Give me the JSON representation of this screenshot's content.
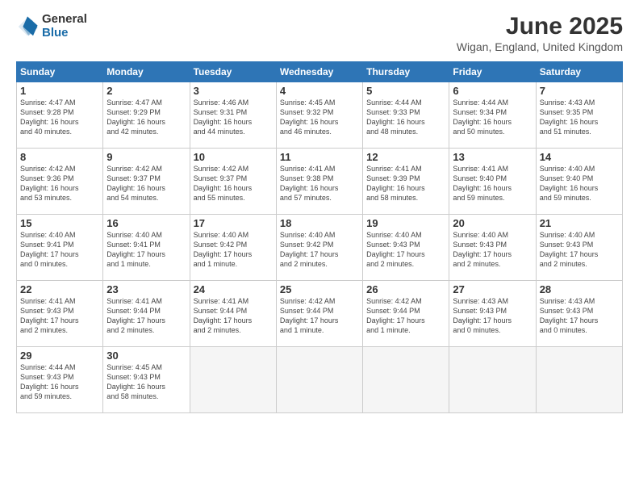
{
  "logo": {
    "general": "General",
    "blue": "Blue"
  },
  "title": "June 2025",
  "location": "Wigan, England, United Kingdom",
  "days_of_week": [
    "Sunday",
    "Monday",
    "Tuesday",
    "Wednesday",
    "Thursday",
    "Friday",
    "Saturday"
  ],
  "weeks": [
    [
      {
        "day": "1",
        "info": "Sunrise: 4:47 AM\nSunset: 9:28 PM\nDaylight: 16 hours\nand 40 minutes."
      },
      {
        "day": "2",
        "info": "Sunrise: 4:47 AM\nSunset: 9:29 PM\nDaylight: 16 hours\nand 42 minutes."
      },
      {
        "day": "3",
        "info": "Sunrise: 4:46 AM\nSunset: 9:31 PM\nDaylight: 16 hours\nand 44 minutes."
      },
      {
        "day": "4",
        "info": "Sunrise: 4:45 AM\nSunset: 9:32 PM\nDaylight: 16 hours\nand 46 minutes."
      },
      {
        "day": "5",
        "info": "Sunrise: 4:44 AM\nSunset: 9:33 PM\nDaylight: 16 hours\nand 48 minutes."
      },
      {
        "day": "6",
        "info": "Sunrise: 4:44 AM\nSunset: 9:34 PM\nDaylight: 16 hours\nand 50 minutes."
      },
      {
        "day": "7",
        "info": "Sunrise: 4:43 AM\nSunset: 9:35 PM\nDaylight: 16 hours\nand 51 minutes."
      }
    ],
    [
      {
        "day": "8",
        "info": "Sunrise: 4:42 AM\nSunset: 9:36 PM\nDaylight: 16 hours\nand 53 minutes."
      },
      {
        "day": "9",
        "info": "Sunrise: 4:42 AM\nSunset: 9:37 PM\nDaylight: 16 hours\nand 54 minutes."
      },
      {
        "day": "10",
        "info": "Sunrise: 4:42 AM\nSunset: 9:37 PM\nDaylight: 16 hours\nand 55 minutes."
      },
      {
        "day": "11",
        "info": "Sunrise: 4:41 AM\nSunset: 9:38 PM\nDaylight: 16 hours\nand 57 minutes."
      },
      {
        "day": "12",
        "info": "Sunrise: 4:41 AM\nSunset: 9:39 PM\nDaylight: 16 hours\nand 58 minutes."
      },
      {
        "day": "13",
        "info": "Sunrise: 4:41 AM\nSunset: 9:40 PM\nDaylight: 16 hours\nand 59 minutes."
      },
      {
        "day": "14",
        "info": "Sunrise: 4:40 AM\nSunset: 9:40 PM\nDaylight: 16 hours\nand 59 minutes."
      }
    ],
    [
      {
        "day": "15",
        "info": "Sunrise: 4:40 AM\nSunset: 9:41 PM\nDaylight: 17 hours\nand 0 minutes."
      },
      {
        "day": "16",
        "info": "Sunrise: 4:40 AM\nSunset: 9:41 PM\nDaylight: 17 hours\nand 1 minute."
      },
      {
        "day": "17",
        "info": "Sunrise: 4:40 AM\nSunset: 9:42 PM\nDaylight: 17 hours\nand 1 minute."
      },
      {
        "day": "18",
        "info": "Sunrise: 4:40 AM\nSunset: 9:42 PM\nDaylight: 17 hours\nand 2 minutes."
      },
      {
        "day": "19",
        "info": "Sunrise: 4:40 AM\nSunset: 9:43 PM\nDaylight: 17 hours\nand 2 minutes."
      },
      {
        "day": "20",
        "info": "Sunrise: 4:40 AM\nSunset: 9:43 PM\nDaylight: 17 hours\nand 2 minutes."
      },
      {
        "day": "21",
        "info": "Sunrise: 4:40 AM\nSunset: 9:43 PM\nDaylight: 17 hours\nand 2 minutes."
      }
    ],
    [
      {
        "day": "22",
        "info": "Sunrise: 4:41 AM\nSunset: 9:43 PM\nDaylight: 17 hours\nand 2 minutes."
      },
      {
        "day": "23",
        "info": "Sunrise: 4:41 AM\nSunset: 9:44 PM\nDaylight: 17 hours\nand 2 minutes."
      },
      {
        "day": "24",
        "info": "Sunrise: 4:41 AM\nSunset: 9:44 PM\nDaylight: 17 hours\nand 2 minutes."
      },
      {
        "day": "25",
        "info": "Sunrise: 4:42 AM\nSunset: 9:44 PM\nDaylight: 17 hours\nand 1 minute."
      },
      {
        "day": "26",
        "info": "Sunrise: 4:42 AM\nSunset: 9:44 PM\nDaylight: 17 hours\nand 1 minute."
      },
      {
        "day": "27",
        "info": "Sunrise: 4:43 AM\nSunset: 9:43 PM\nDaylight: 17 hours\nand 0 minutes."
      },
      {
        "day": "28",
        "info": "Sunrise: 4:43 AM\nSunset: 9:43 PM\nDaylight: 17 hours\nand 0 minutes."
      }
    ],
    [
      {
        "day": "29",
        "info": "Sunrise: 4:44 AM\nSunset: 9:43 PM\nDaylight: 16 hours\nand 59 minutes."
      },
      {
        "day": "30",
        "info": "Sunrise: 4:45 AM\nSunset: 9:43 PM\nDaylight: 16 hours\nand 58 minutes."
      },
      {
        "day": "",
        "info": ""
      },
      {
        "day": "",
        "info": ""
      },
      {
        "day": "",
        "info": ""
      },
      {
        "day": "",
        "info": ""
      },
      {
        "day": "",
        "info": ""
      }
    ]
  ]
}
